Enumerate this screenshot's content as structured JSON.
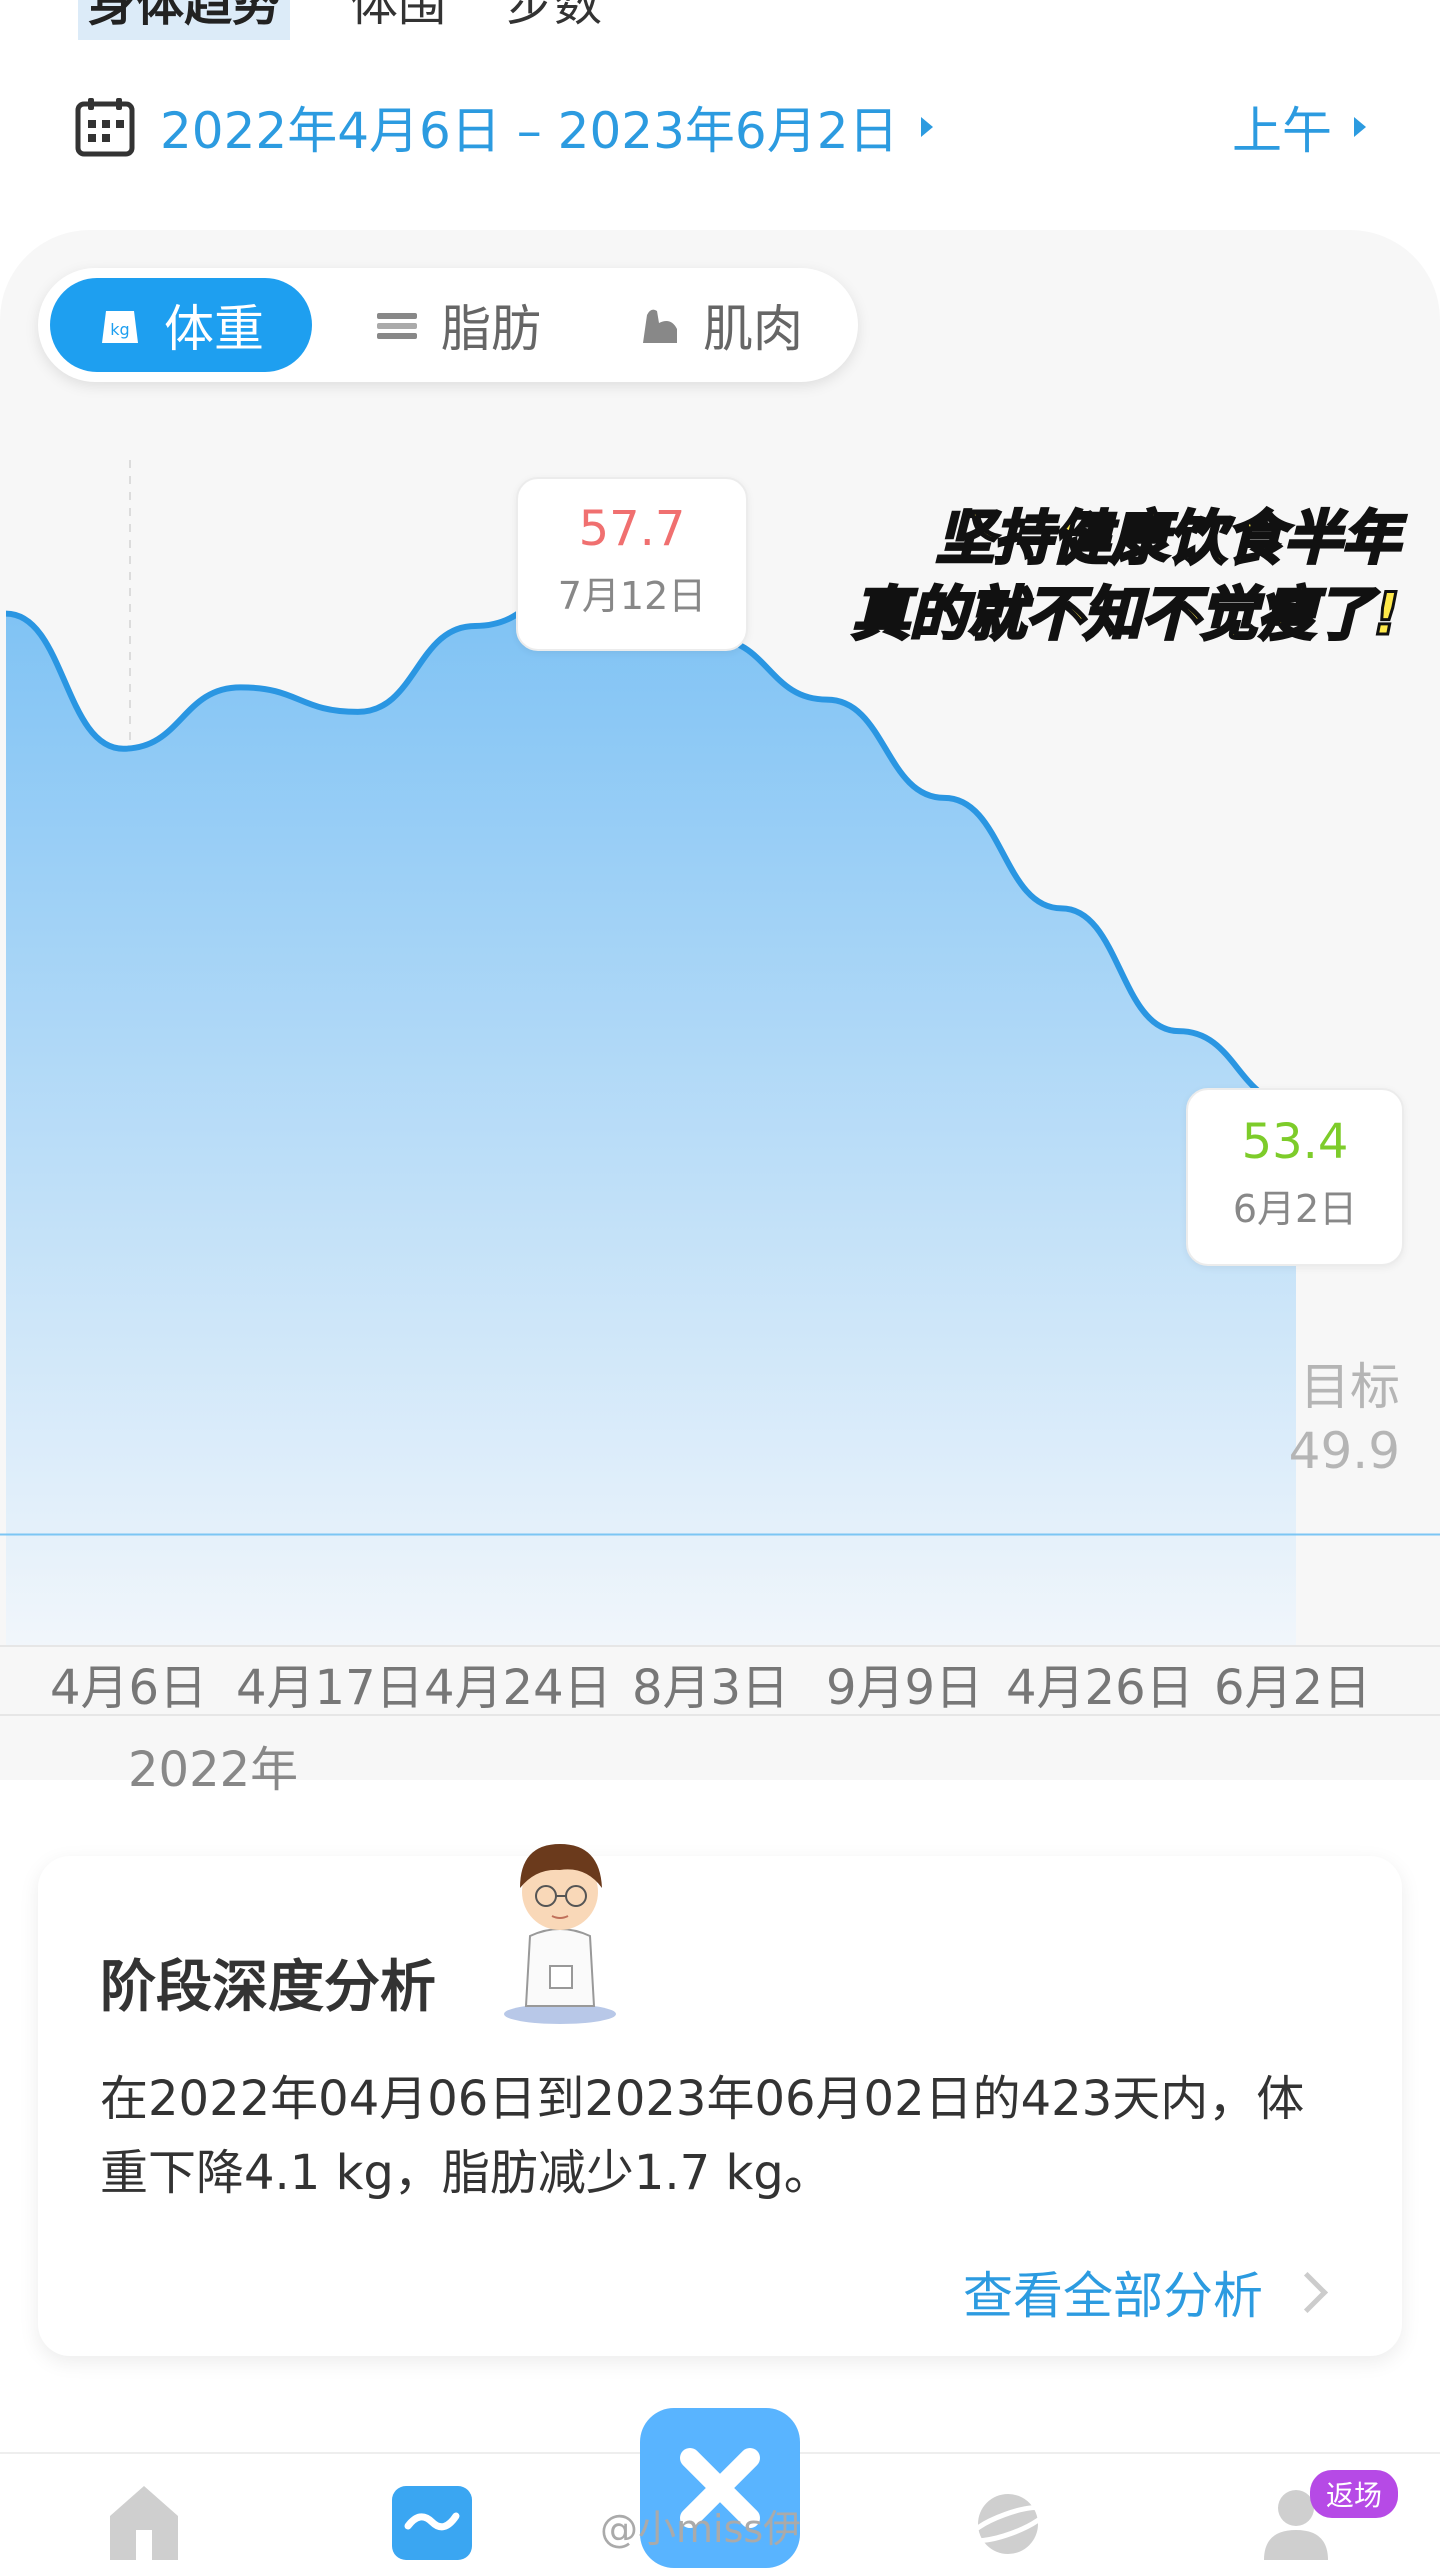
{
  "top_tabs": [
    "身体趋势",
    "体围",
    "步数"
  ],
  "date_range": "2022年4月6日 – 2023年6月2日",
  "period_selector": "上午",
  "metric_tabs": [
    {
      "label": "体重",
      "icon": "kg-scale-icon",
      "active": true
    },
    {
      "label": "脂肪",
      "icon": "fat-icon",
      "active": false
    },
    {
      "label": "肌肉",
      "icon": "muscle-icon",
      "active": false
    }
  ],
  "caption": [
    "坚持健康饮食半年",
    "真的就不知不觉瘦了!"
  ],
  "tooltip_max": {
    "value": "57.7",
    "date": "7月12日"
  },
  "tooltip_last": {
    "value": "53.4",
    "date": "6月2日"
  },
  "goal": {
    "label": "目标",
    "value": "49.9"
  },
  "x_labels": [
    "4月6日",
    "4月17日",
    "4月24日",
    "8月3日",
    "9月9日",
    "4月26日",
    "6月2日"
  ],
  "year_label": "2022年",
  "analysis": {
    "title": "阶段深度分析",
    "text": "在2022年04月06日到2023年06月02日的423天内，体重下降4.1 kg，脂肪减少1.7 kg。",
    "link": "查看全部分析"
  },
  "bottom_nav": [
    "home-icon",
    "trend-icon",
    "center-app-icon",
    "planet-icon",
    "profile-icon"
  ],
  "badge": "返场",
  "watermark": "@小miss伊",
  "colors": {
    "accent": "#1e9ff0",
    "max_value": "#f07070",
    "last_value": "#7dcc2a",
    "line": "#2a96e2"
  },
  "chart_data": {
    "type": "area",
    "x": [
      "4月6日",
      "4月17日",
      "4月24日",
      "8月3日",
      "9月9日",
      "4月26日",
      "6月2日"
    ],
    "series": [
      {
        "values": [
          57.4,
          56.3,
          56.8,
          56.6,
          57.3,
          57.7,
          57.2,
          56.7,
          55.9,
          55.0,
          54.0,
          53.4
        ]
      }
    ],
    "ylim": [
      49,
      58
    ],
    "goal": 49.9,
    "annotations": [
      {
        "label": "57.7",
        "date": "7月12日"
      },
      {
        "label": "53.4",
        "date": "6月2日"
      }
    ]
  }
}
